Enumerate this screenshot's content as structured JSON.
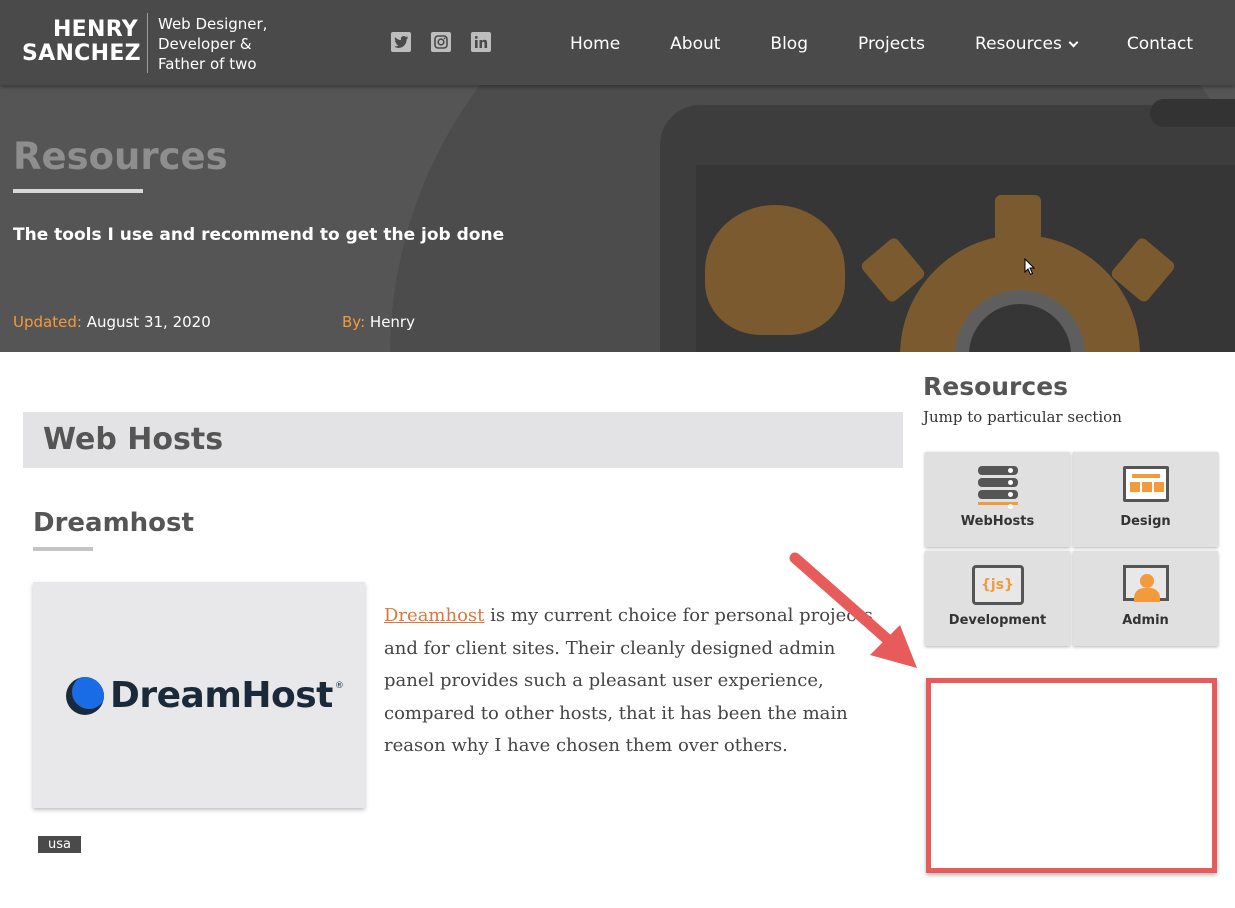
{
  "header": {
    "logo_line1": "HENRY",
    "logo_line2": "SANCHEZ",
    "tagline_1": "Web Designer,",
    "tagline_2": "Developer &",
    "tagline_3": "Father of two",
    "social": [
      "twitter-icon",
      "instagram-icon",
      "linkedin-icon"
    ],
    "nav": {
      "home": "Home",
      "about": "About",
      "blog": "Blog",
      "projects": "Projects",
      "resources": "Resources",
      "contact": "Contact"
    }
  },
  "hero": {
    "title": "Resources",
    "subtitle": "The tools I use and recommend to get the job done",
    "updated_label": "Updated:",
    "updated_value": "August 31, 2020",
    "by_label": "By:",
    "by_value": "Henry"
  },
  "main": {
    "section_title": "Web Hosts",
    "host": {
      "name": "Dreamhost",
      "logo_text": "DreamHost",
      "logo_mark": "®",
      "link_text": "Dreamhost",
      "description": " is my current choice for personal projects and for client sites. Their cleanly designed admin panel provides such a pleasant user experience, compared to other hosts, that it has been the main reason why I have chosen them over others.",
      "tag": "usa"
    }
  },
  "sidebar": {
    "title": "Resources",
    "subtitle": "Jump to particular section",
    "tiles": {
      "webhosts": "WebHosts",
      "design": "Design",
      "development": "Development",
      "development_glyph": "{js}",
      "admin": "Admin"
    }
  },
  "colors": {
    "accent": "#f39a3c",
    "link": "#e0763a",
    "annotation": "#e85b5b",
    "header_bg": "#4a4a4a"
  }
}
